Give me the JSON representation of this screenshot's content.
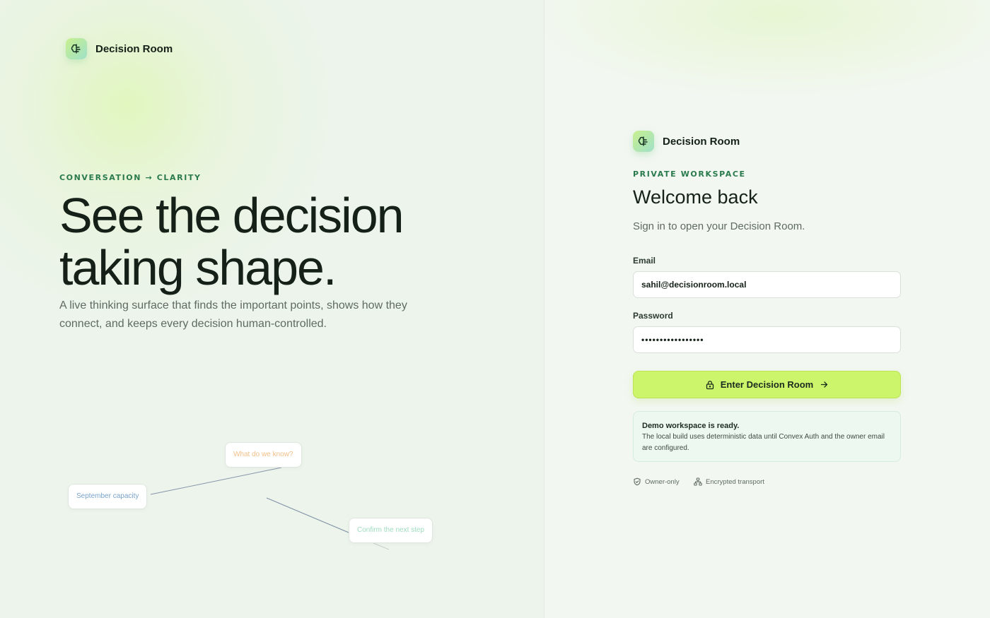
{
  "app": {
    "name": "Decision Room"
  },
  "hero": {
    "eyebrow": "CONVERSATION → CLARITY",
    "headline_line1": "See the decision",
    "headline_line2": "taking shape.",
    "lede": "A live thinking surface that finds the important points, shows how they connect, and keeps every decision human-controlled."
  },
  "graph": {
    "nodes": [
      {
        "label": "What do we know?",
        "color": "#f2bf86"
      },
      {
        "label": "September capacity",
        "color": "#7aa3c9"
      },
      {
        "label": "Confirm the next step",
        "color": "#9fdcc0"
      }
    ]
  },
  "auth": {
    "brand": "Decision Room",
    "eyebrow": "PRIVATE WORKSPACE",
    "title": "Welcome back",
    "subtitle": "Sign in to open your Decision Room.",
    "email_label": "Email",
    "email_value": "sahil@decisionroom.local",
    "password_label": "Password",
    "password_value": "•••••••••••••••••",
    "submit_label": "Enter Decision Room",
    "notice_title": "Demo workspace is ready.",
    "notice_body": "The local build uses deterministic data until Convex Auth and the owner email are configured.",
    "meta_owner": "Owner-only",
    "meta_transport": "Encrypted transport"
  },
  "colors": {
    "accent": "#cdf56b",
    "eyebrow": "#2a7a4e",
    "text": "#152118",
    "muted": "#5f6b62"
  },
  "icons": [
    "brain-icon",
    "lock-icon",
    "arrow-right-icon",
    "shield-icon",
    "network-icon"
  ]
}
